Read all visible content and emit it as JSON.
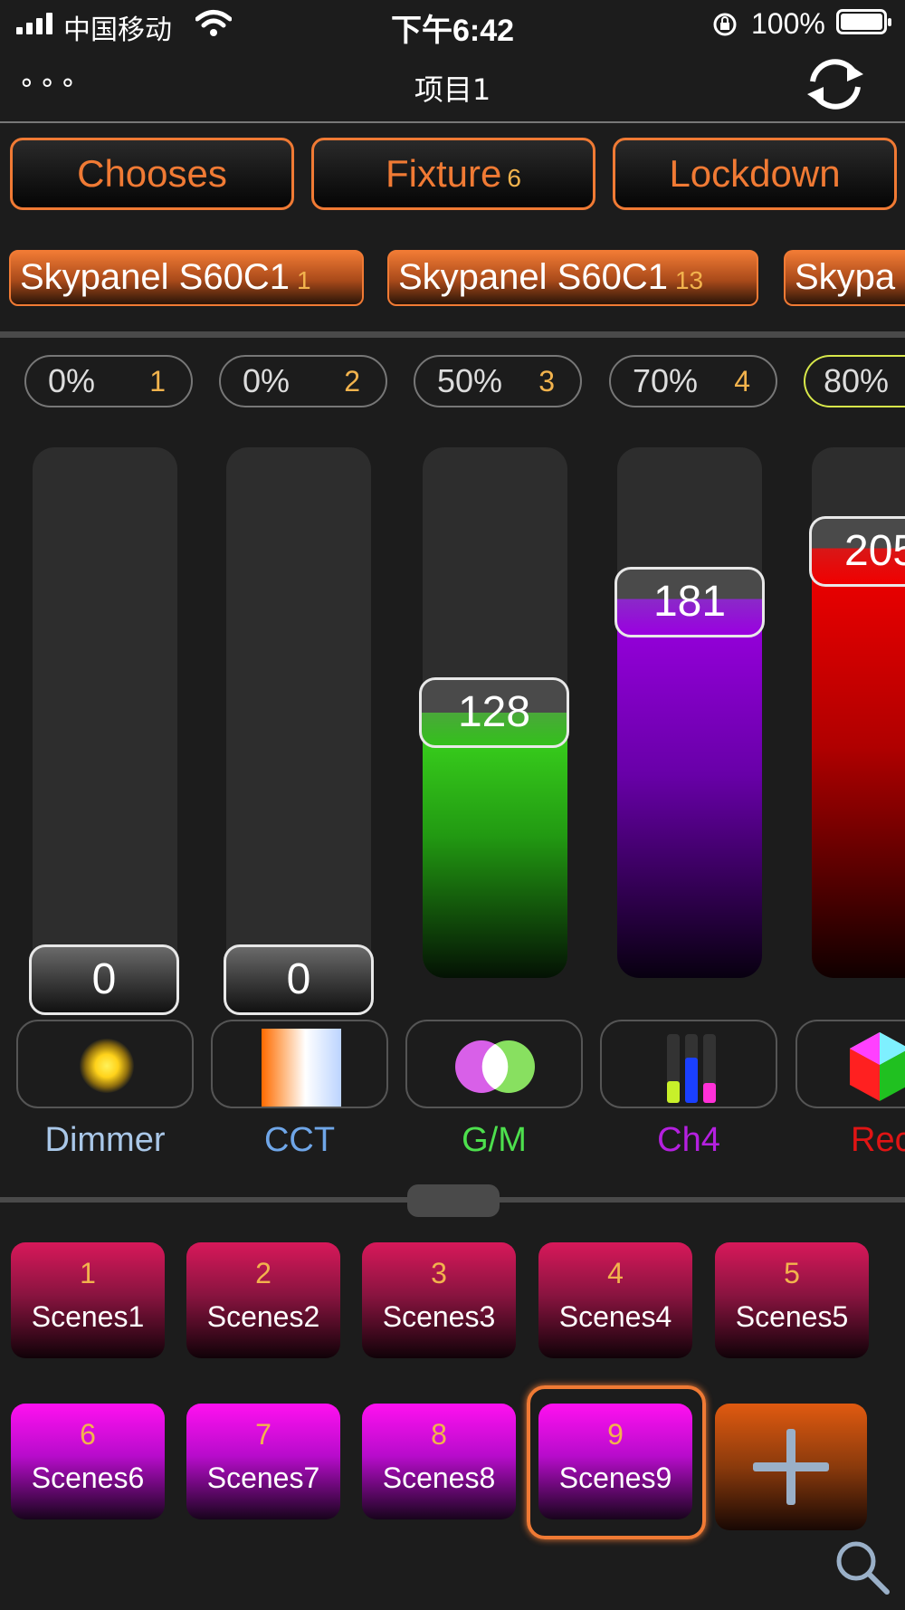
{
  "status_bar": {
    "carrier": "中国移动",
    "time": "下午6:42",
    "battery_percent": "100%"
  },
  "nav": {
    "title": "项目1",
    "more_dots": "∘∘∘"
  },
  "top_buttons": {
    "chooses": "Chooses",
    "fixture": "Fixture",
    "fixture_count": "6",
    "lockdown": "Lockdown"
  },
  "fixtures": [
    {
      "name": "Skypanel S60C1",
      "num": "1"
    },
    {
      "name": "Skypanel S60C1",
      "num": "13"
    },
    {
      "name": "Skypa",
      "num": ""
    }
  ],
  "channels": [
    {
      "percent": "0%",
      "num": "1",
      "value": "0",
      "label": "Dimmer",
      "label_color": "#a9c7e8",
      "level": 0
    },
    {
      "percent": "0%",
      "num": "2",
      "value": "0",
      "label": "CCT",
      "label_color": "#6fa6e8",
      "level": 0
    },
    {
      "percent": "50%",
      "num": "3",
      "value": "128",
      "label": "G/M",
      "label_color": "#4de04d",
      "level": 0.5
    },
    {
      "percent": "70%",
      "num": "4",
      "value": "181",
      "label": "Ch4",
      "label_color": "#b520e0",
      "level": 0.71
    },
    {
      "percent": "80%",
      "num": "",
      "value": "205",
      "label": "Rec",
      "label_color": "#e01414",
      "level": 0.8
    }
  ],
  "scenes": [
    {
      "num": "1",
      "label": "Scenes1"
    },
    {
      "num": "2",
      "label": "Scenes2"
    },
    {
      "num": "3",
      "label": "Scenes3"
    },
    {
      "num": "4",
      "label": "Scenes4"
    },
    {
      "num": "5",
      "label": "Scenes5"
    },
    {
      "num": "6",
      "label": "Scenes6"
    },
    {
      "num": "7",
      "label": "Scenes7"
    },
    {
      "num": "8",
      "label": "Scenes8"
    },
    {
      "num": "9",
      "label": "Scenes9",
      "selected": true
    }
  ],
  "colors": {
    "accent_orange": "#f07a34",
    "number_gold": "#f2b34d",
    "scene_red": "#d8185a",
    "scene_magenta": "#ff10f0"
  },
  "icons": [
    "signal-icon",
    "wifi-icon",
    "rotation-lock-icon",
    "battery-icon",
    "sync-icon",
    "sun-icon",
    "cct-gradient-icon",
    "green-magenta-icon",
    "channel-bars-icon",
    "color-cube-icon",
    "add-icon",
    "search-icon"
  ]
}
